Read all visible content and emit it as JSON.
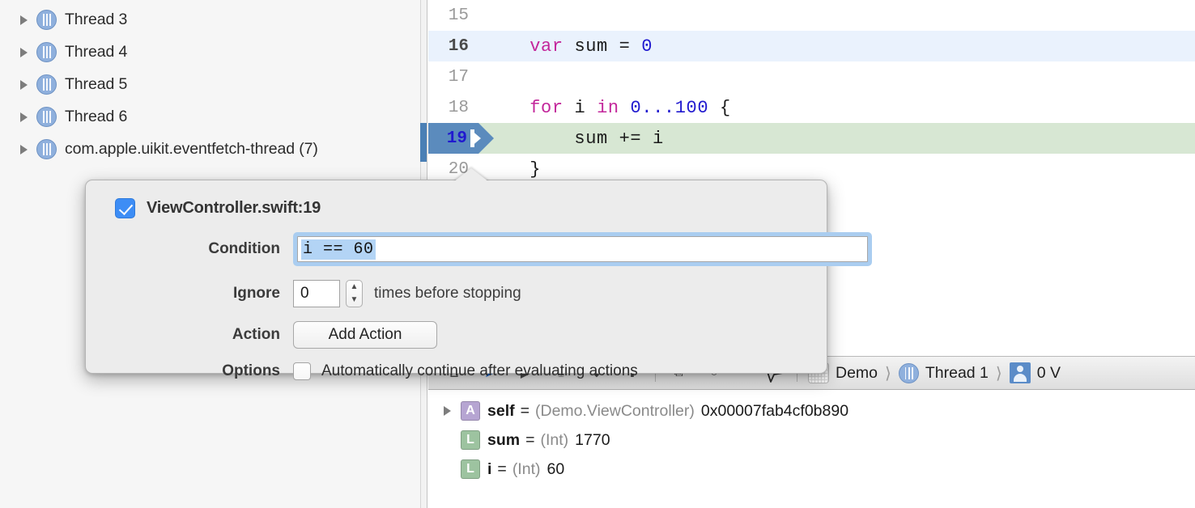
{
  "navigator": {
    "threads": [
      {
        "label": "Thread 3",
        "icon": "thread-icon"
      },
      {
        "label": "Thread 4",
        "icon": "thread-icon"
      },
      {
        "label": "Thread 5",
        "icon": "thread-icon"
      },
      {
        "label": "Thread 6",
        "icon": "thread-icon"
      },
      {
        "label": "com.apple.uikit.eventfetch-thread (7)",
        "icon": "thread-icon"
      }
    ]
  },
  "editor": {
    "lines": [
      {
        "number": "15",
        "tokens": [],
        "state": "normal"
      },
      {
        "number": "16",
        "tokens": [
          {
            "t": "    ",
            "c": "pln"
          },
          {
            "t": "var",
            "c": "kw"
          },
          {
            "t": " sum = ",
            "c": "pln"
          },
          {
            "t": "0",
            "c": "num"
          }
        ],
        "state": "current"
      },
      {
        "number": "17",
        "tokens": [],
        "state": "normal"
      },
      {
        "number": "18",
        "tokens": [
          {
            "t": "    ",
            "c": "pln"
          },
          {
            "t": "for",
            "c": "kw"
          },
          {
            "t": " i ",
            "c": "pln"
          },
          {
            "t": "in",
            "c": "kw"
          },
          {
            "t": " ",
            "c": "pln"
          },
          {
            "t": "0",
            "c": "num"
          },
          {
            "t": "...",
            "c": "num"
          },
          {
            "t": "100",
            "c": "num"
          },
          {
            "t": " {",
            "c": "pln"
          }
        ],
        "state": "normal"
      },
      {
        "number": "19",
        "tokens": [
          {
            "t": "        sum += i",
            "c": "pln"
          }
        ],
        "state": "stopped"
      },
      {
        "number": "20",
        "tokens": [
          {
            "t": "    }",
            "c": "pln"
          }
        ],
        "state": "normal"
      }
    ]
  },
  "popover": {
    "enabled_checkbox": "checked",
    "title": "ViewController.swift:19",
    "condition": {
      "label": "Condition",
      "value": "i == 60",
      "placeholder": "Condition",
      "focused": true,
      "selected": true
    },
    "ignore": {
      "label": "Ignore",
      "value": "0",
      "suffix": "times before stopping"
    },
    "action": {
      "label": "Action",
      "button": "Add Action"
    },
    "options": {
      "label": "Options",
      "checkbox_label": "Automatically continue after evaluating actions",
      "checked": false
    }
  },
  "debug_bar": {
    "buttons": [
      {
        "name": "hide-debug-area-button",
        "glyph": "⊔"
      },
      {
        "name": "activate-breakpoints-button",
        "glyph": "➤",
        "active": true
      },
      {
        "name": "continue-button",
        "glyph": "▶"
      },
      {
        "name": "step-over-button",
        "glyph": "⤓"
      },
      {
        "name": "step-into-button",
        "glyph": "⬇"
      },
      {
        "name": "step-out-button",
        "glyph": "⬆"
      },
      {
        "name": "debug-view-hierarchy-button",
        "glyph": "⧉"
      },
      {
        "name": "simulate-location-button",
        "glyph": "○"
      }
    ],
    "location_icon": "navigation-arrow-icon",
    "jumpbar": [
      {
        "label": "Demo",
        "icon": "project-icon"
      },
      {
        "label": "Thread 1",
        "icon": "thread-icon"
      },
      {
        "label": "0 V",
        "icon": "stack-frame-icon"
      }
    ]
  },
  "variables": {
    "rows": [
      {
        "disclosure": "closed",
        "badge": "A",
        "badge_kind": "arg",
        "name": "self",
        "eq": "=",
        "type": "(Demo.ViewController)",
        "value": "0x00007fab4cf0b890"
      },
      {
        "disclosure": "none",
        "badge": "L",
        "badge_kind": "local",
        "name": "sum",
        "eq": "=",
        "type": "(Int)",
        "value": "1770"
      },
      {
        "disclosure": "none",
        "badge": "L",
        "badge_kind": "local",
        "name": "i",
        "eq": "=",
        "type": "(Int)",
        "value": "60"
      }
    ]
  },
  "colors": {
    "keyword": "#c3279b",
    "number": "#2019cf",
    "current_line_bg": "#eaf2fd",
    "stopped_line_bg": "#d7e7d3",
    "breakpoint_blue": "#5b8bbd",
    "checkbox_blue": "#3d8df5",
    "focus_ring": "#aacdf0",
    "selection": "#b3d4f5",
    "arg_badge": "#b6a5d2",
    "local_badge": "#9dc3a0"
  }
}
